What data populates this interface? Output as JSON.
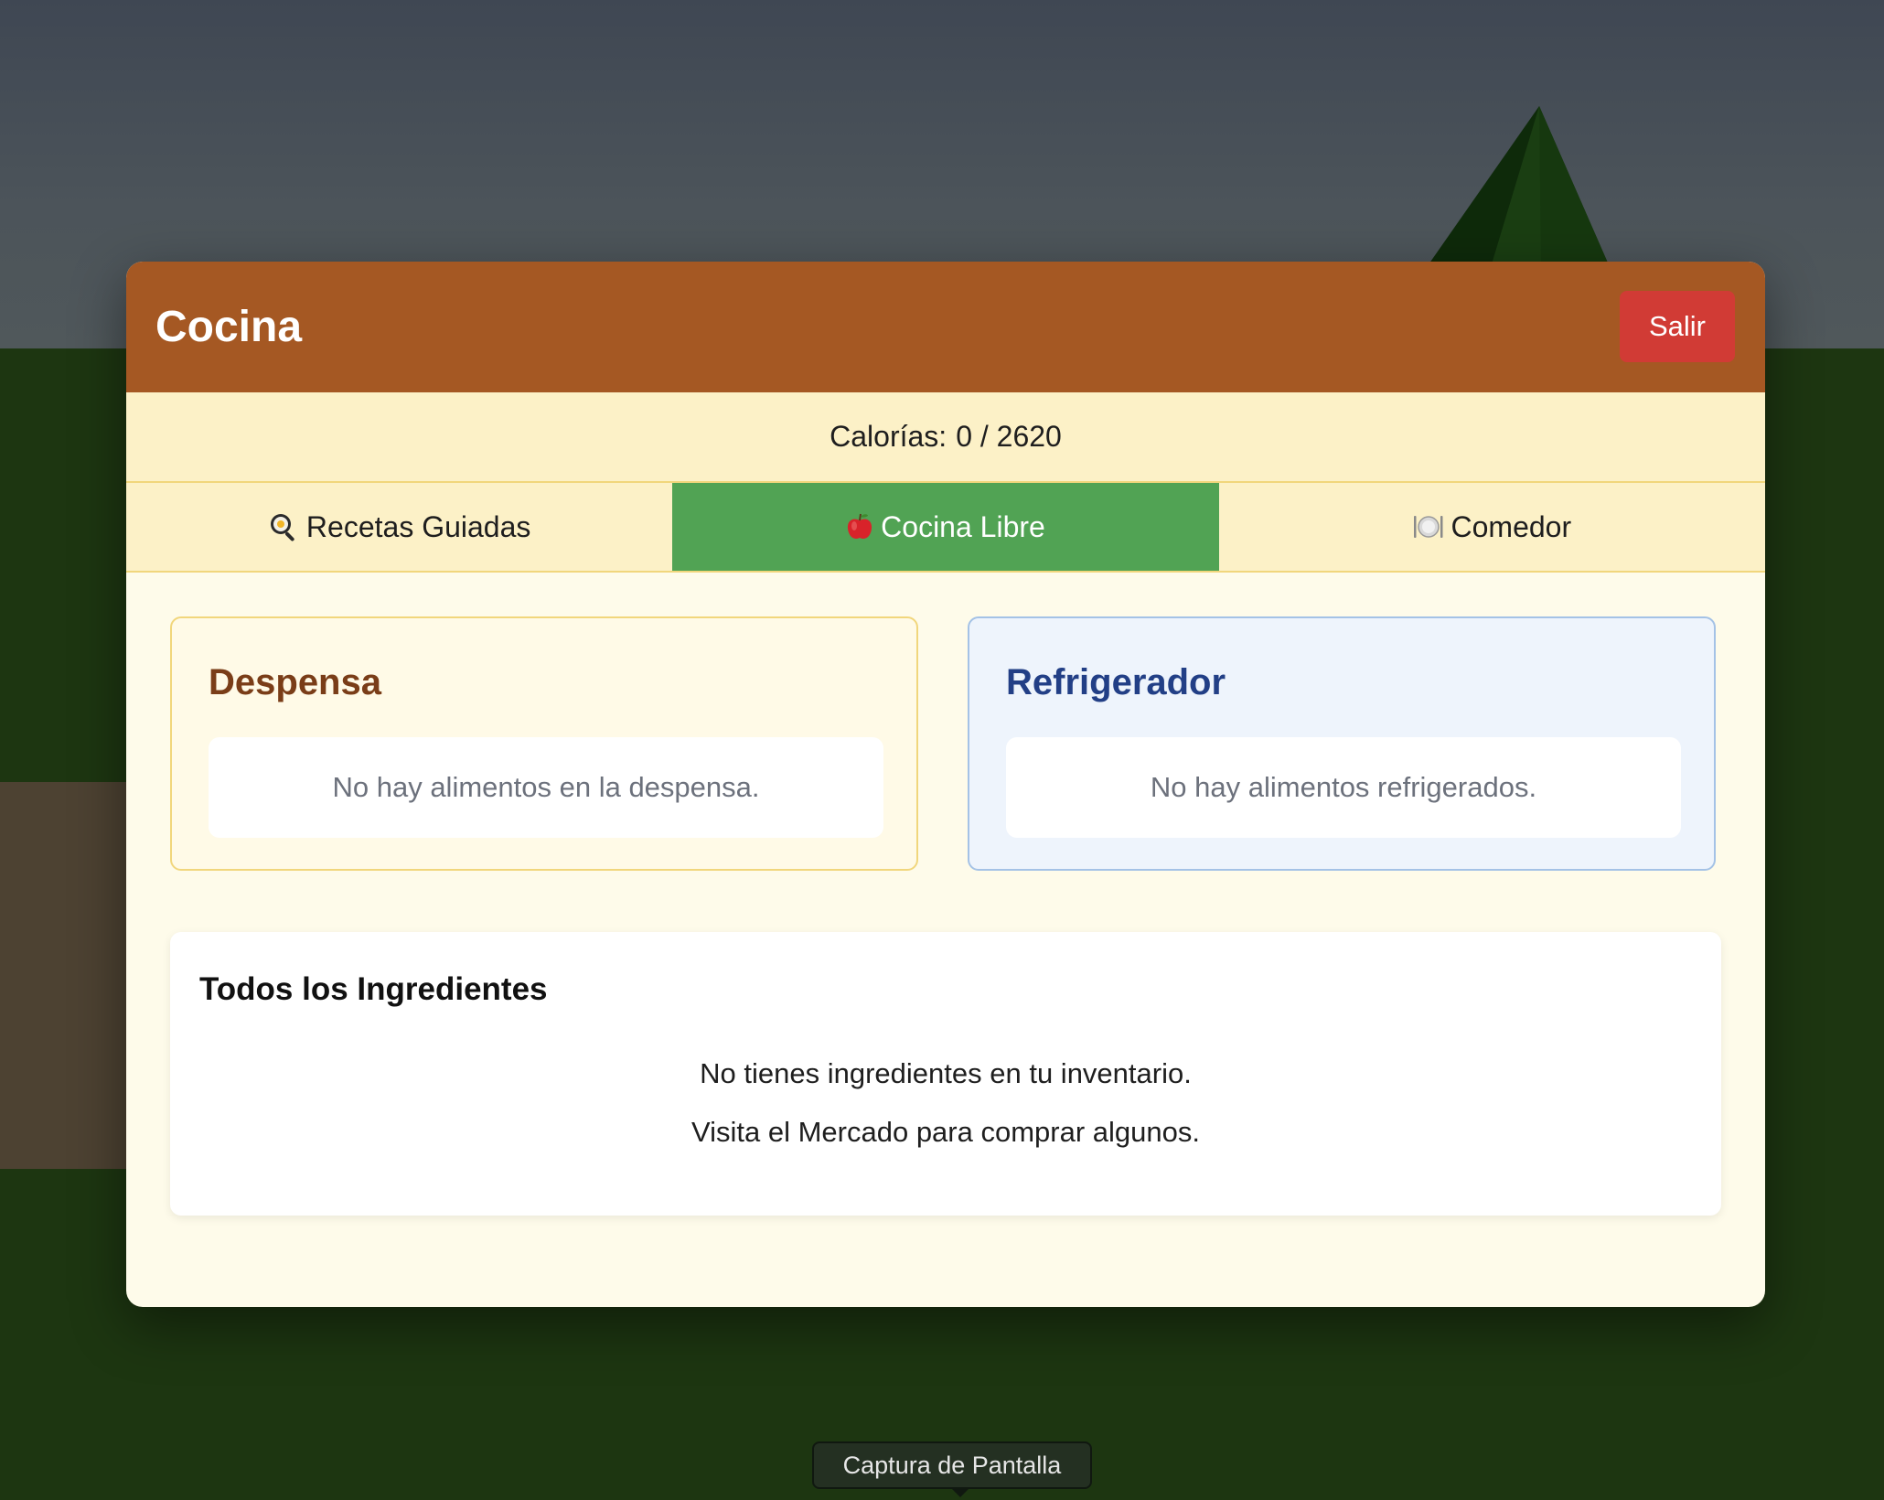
{
  "modal": {
    "title": "Cocina",
    "exit_label": "Salir"
  },
  "calories": {
    "label": "Calorías:",
    "value": "0 / 2620"
  },
  "tabs": [
    {
      "label": "Recetas Guiadas",
      "icon": "frying-pan-egg-icon",
      "active": false
    },
    {
      "label": "Cocina Libre",
      "icon": "apple-icon",
      "active": true
    },
    {
      "label": "Comedor",
      "icon": "plate-cutlery-icon",
      "active": false
    }
  ],
  "pantry": {
    "title": "Despensa",
    "empty_message": "No hay alimentos en la despensa."
  },
  "fridge": {
    "title": "Refrigerador",
    "empty_message": "No hay alimentos refrigerados."
  },
  "ingredients": {
    "title": "Todos los Ingredientes",
    "empty_line_1": "No tienes ingredientes en tu inventario.",
    "empty_line_2": "Visita el Mercado para comprar algunos."
  },
  "tooltip": {
    "label": "Captura de Pantalla"
  },
  "colors": {
    "header": "#a55823",
    "exit_button": "#d13b35",
    "active_tab": "#51a354",
    "pantry_title": "#7a3d18",
    "fridge_title": "#223f86"
  }
}
